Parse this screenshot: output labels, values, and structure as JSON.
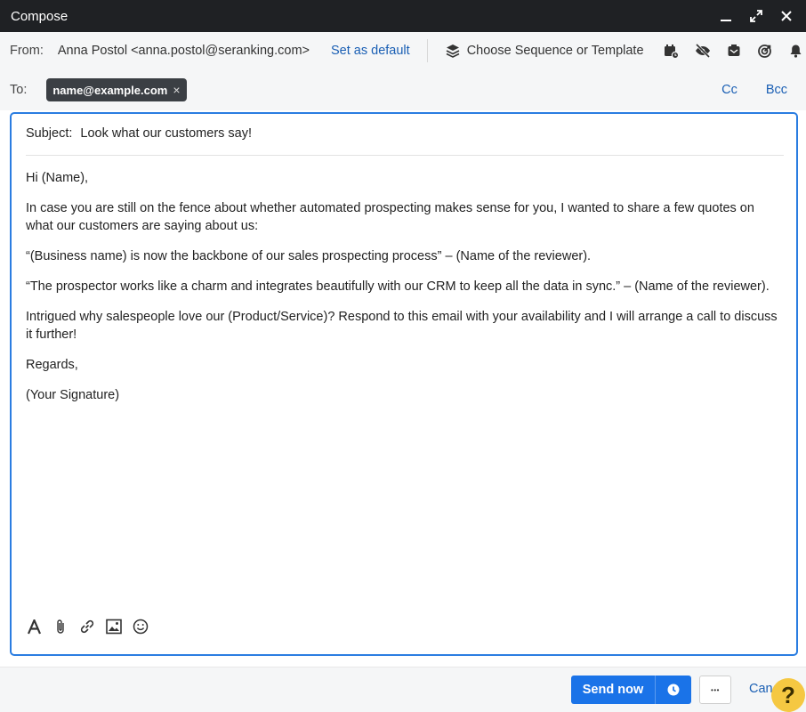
{
  "window": {
    "title": "Compose",
    "controls": [
      "minimize-icon",
      "expand-icon",
      "close-icon"
    ]
  },
  "from": {
    "label": "From:",
    "sender": "Anna Postol <anna.postol@seranking.com>",
    "set_default": "Set as default",
    "sequence_label": "Choose Sequence or Template",
    "tools": [
      "calendar-clock-icon",
      "tracking-off-icon",
      "inbox-icon",
      "target-icon",
      "bell-icon"
    ]
  },
  "to": {
    "label": "To:",
    "recipient": "name@example.com",
    "remove": "×",
    "cc": "Cc",
    "bcc": "Bcc"
  },
  "subject": {
    "label": "Subject:",
    "value": "Look what our customers say!"
  },
  "body": {
    "paragraphs": [
      "Hi (Name),",
      "In case you are still on the fence about whether automated prospecting makes sense for you, I wanted to share a few quotes on what our customers are saying about us:",
      "“(Business name) is now the backbone of our sales prospecting process” – (Name of the reviewer).",
      "“The prospector works like a charm and integrates beautifully with our CRM to keep all the data in sync.” – (Name of the reviewer).",
      "Intrigued why salespeople love our (Product/Service)? Respond to this email with your availability and I will arrange a call to discuss it further!",
      "Regards,",
      "(Your Signature)"
    ]
  },
  "format_tools": [
    "text-format-icon",
    "attachment-icon",
    "link-icon",
    "image-icon",
    "emoji-icon"
  ],
  "footer": {
    "send_label": "Send now",
    "schedule_icon": "clock-icon",
    "more_label": "•••",
    "cancel_label": "Cancel"
  },
  "help": {
    "label": "?"
  },
  "colors": {
    "titlebar": "#1f2124",
    "accent": "#1a73e8",
    "link": "#1a5fb4",
    "help": "#f5c842"
  }
}
